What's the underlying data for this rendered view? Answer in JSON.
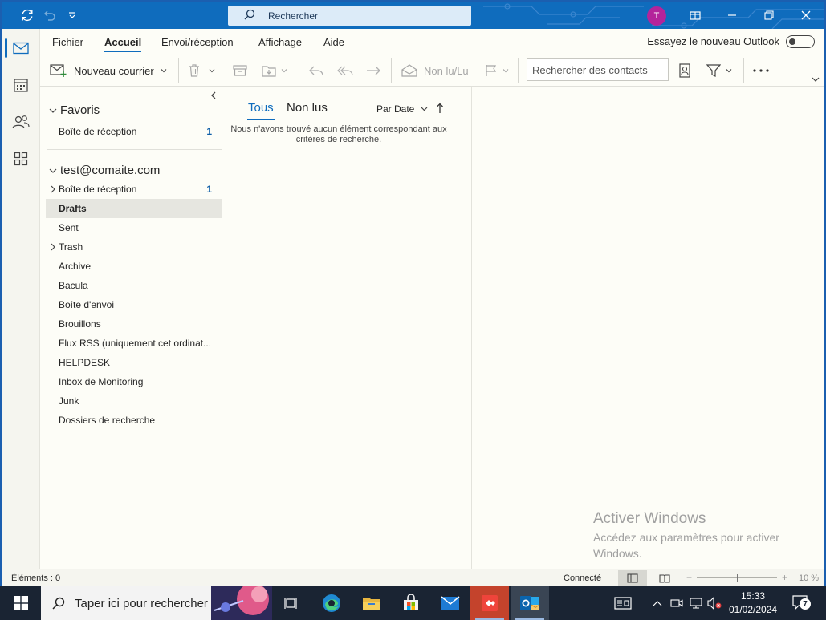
{
  "titlebar": {
    "search_placeholder": "Rechercher",
    "avatar_initial": "T"
  },
  "menu": {
    "tabs": [
      "Fichier",
      "Accueil",
      "Envoi/réception",
      "Affichage",
      "Aide"
    ],
    "active_tab": "Accueil",
    "try_new_outlook": "Essayez le nouveau Outlook"
  },
  "ribbon": {
    "new_mail": "Nouveau courrier",
    "read_unread": "Non lu/Lu",
    "contact_search_placeholder": "Rechercher des contacts"
  },
  "favorites": {
    "title": "Favoris",
    "items": [
      {
        "label": "Boîte de réception",
        "count": "1"
      }
    ]
  },
  "account": {
    "title": "test@comaite.com",
    "folders": [
      {
        "label": "Boîte de réception",
        "count": "1",
        "expandable": true
      },
      {
        "label": "Drafts",
        "count": "",
        "selected": true
      },
      {
        "label": "Sent",
        "count": ""
      },
      {
        "label": "Trash",
        "count": "",
        "expandable": true
      },
      {
        "label": "Archive",
        "count": ""
      },
      {
        "label": "Bacula",
        "count": ""
      },
      {
        "label": "Boîte d'envoi",
        "count": ""
      },
      {
        "label": "Brouillons",
        "count": ""
      },
      {
        "label": "Flux RSS (uniquement cet ordinat...",
        "count": ""
      },
      {
        "label": "HELPDESK",
        "count": ""
      },
      {
        "label": "Inbox de Monitoring",
        "count": ""
      },
      {
        "label": "Junk",
        "count": ""
      },
      {
        "label": "Dossiers de recherche",
        "count": ""
      }
    ]
  },
  "message_list": {
    "tab_all": "Tous",
    "tab_unread": "Non lus",
    "sort_label": "Par Date",
    "empty_message": "Nous n'avons trouvé aucun élément correspondant aux critères de recherche."
  },
  "watermark": {
    "title": "Activer Windows",
    "subtitle": "Accédez aux paramètres pour activer Windows."
  },
  "statusbar": {
    "items_label": "Éléments : 0",
    "connection": "Connecté",
    "zoom": "10 %",
    "zoom_level_percent": 10
  },
  "taskbar": {
    "search_placeholder": "Taper ici pour rechercher",
    "time": "15:33",
    "date": "01/02/2024",
    "notification_count": "7"
  },
  "colors": {
    "accent": "#0f6cbd",
    "avatar": "#b4249b",
    "taskbar": "#1a2433"
  }
}
